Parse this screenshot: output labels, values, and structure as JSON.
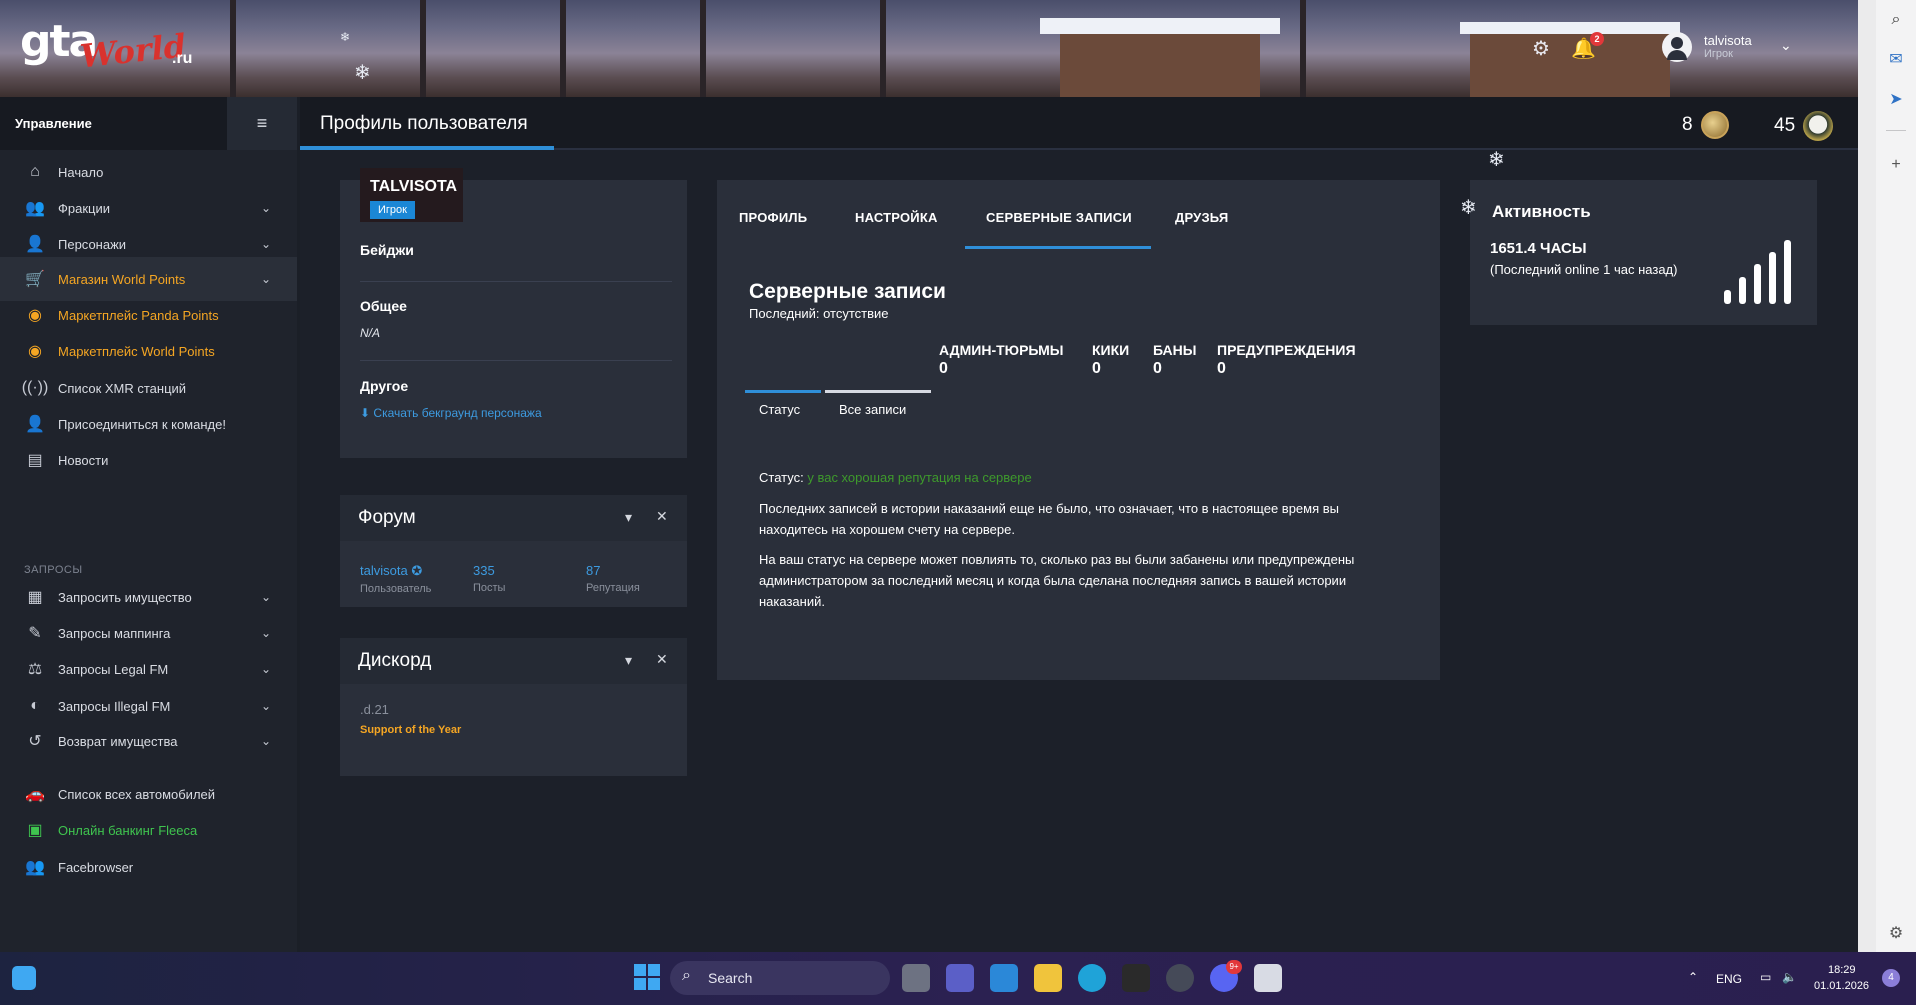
{
  "logo": {
    "gta": "gta",
    "world": "World",
    "ru": ".ru"
  },
  "header": {
    "notif_count": "2",
    "user": {
      "name": "talvisota",
      "role": "Игрок"
    }
  },
  "sidebar": {
    "title": "Управление",
    "items": [
      {
        "label": "Начало",
        "icon": "home-icon"
      },
      {
        "label": "Фракции",
        "icon": "users-icon"
      },
      {
        "label": "Персонажи",
        "icon": "user-icon"
      },
      {
        "label": "Магазин World Points",
        "icon": "cart-icon"
      },
      {
        "label": "Маркетплейс Panda Points",
        "icon": "coins-icon"
      },
      {
        "label": "Маркетплейс World Points",
        "icon": "coins-icon"
      },
      {
        "label": "Список XMR станций",
        "icon": "broadcast-icon"
      },
      {
        "label": "Присоединиться к команде!",
        "icon": "user-plus-icon"
      },
      {
        "label": "Новости",
        "icon": "newspaper-icon"
      }
    ],
    "section_label": "ЗАПРОСЫ",
    "request_items": [
      {
        "label": "Запросить имущество",
        "icon": "building-icon"
      },
      {
        "label": "Запросы маппинга",
        "icon": "brush-icon"
      },
      {
        "label": "Запросы Legal FM",
        "icon": "scale-icon"
      },
      {
        "label": "Запросы Illegal FM",
        "icon": "mask-icon"
      },
      {
        "label": "Возврат имущества",
        "icon": "undo-icon"
      }
    ],
    "bottom_items": [
      {
        "label": "Список всех автомобилей",
        "icon": "car-icon"
      },
      {
        "label": "Онлайн банкинг Fleeca",
        "icon": "bank-icon"
      },
      {
        "label": "Facebrowser",
        "icon": "people-icon"
      }
    ]
  },
  "titlebar": {
    "title": "Профиль пользователя",
    "stat1": "8",
    "stat2": "45"
  },
  "profile": {
    "nickname": "TALVISOTA",
    "role": "Игрок",
    "badges_title": "Бейджи",
    "general_title": "Общее",
    "general_value": "N/A",
    "other_title": "Другое",
    "download_link": "Скачать бекграунд персонажа"
  },
  "forum": {
    "title": "Форум",
    "username": "talvisota",
    "username_label": "Пользователь",
    "posts": "335",
    "posts_label": "Посты",
    "reputation": "87",
    "reputation_label": "Репутация"
  },
  "discord": {
    "title": "Дискорд",
    "handle": ".d.21",
    "award": "Support of the Year"
  },
  "tabs": [
    {
      "label": "ПРОФИЛЬ"
    },
    {
      "label": "НАСТРОЙКА"
    },
    {
      "label": "СЕРВЕРНЫЕ ЗАПИСИ"
    },
    {
      "label": "ДРУЗЬЯ"
    }
  ],
  "records": {
    "title": "Серверные записи",
    "last": "Последний: отсутствие",
    "counters": [
      {
        "label": "АДМИН-ТЮРЬМЫ",
        "value": "0"
      },
      {
        "label": "КИКИ",
        "value": "0"
      },
      {
        "label": "БАНЫ",
        "value": "0"
      },
      {
        "label": "ПРЕДУПРЕЖДЕНИЯ",
        "value": "0"
      }
    ],
    "subtabs": [
      "Статус",
      "Все записи"
    ],
    "status_label": "Статус:",
    "status_value": "у вас хорошая репутация на сервере",
    "para1": "Последних записей в истории наказаний еще не было, что означает, что в настоящее время вы находитесь на хорошем счету на сервере.",
    "para2": "На ваш статус на сервере может повлиять то, сколько раз вы были забанены или предупреждены администратором за последний месяц и когда была сделана последняя запись в вашей истории наказаний."
  },
  "activity": {
    "title": "Активность",
    "hours": "1651.4 ЧАСЫ",
    "last_online": "(Последний online 1 час назад)"
  },
  "taskbar": {
    "search": "Search",
    "lang": "ENG",
    "time": "18:29",
    "date": "01.01.2026",
    "discord_badge": "9+",
    "notif": "4"
  },
  "colors": {
    "accent": "#2f8fd8",
    "orange": "#f5a623",
    "green": "#3fc44f",
    "status_good": "#3e9a2c"
  }
}
